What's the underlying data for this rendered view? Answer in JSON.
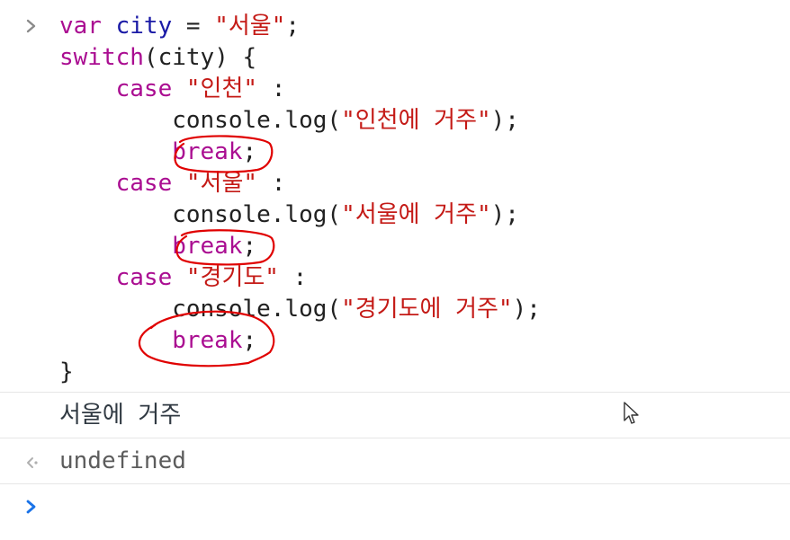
{
  "input": {
    "lines": [
      [
        {
          "t": "var",
          "c": "kw"
        },
        {
          "t": " ",
          "c": "op"
        },
        {
          "t": "city",
          "c": "var-name"
        },
        {
          "t": " = ",
          "c": "op"
        },
        {
          "t": "\"서울\"",
          "c": "str"
        },
        {
          "t": ";",
          "c": "op"
        }
      ],
      [
        {
          "t": "switch",
          "c": "kw"
        },
        {
          "t": "(city) {",
          "c": "op"
        }
      ],
      [
        {
          "t": "    case ",
          "c": "kw"
        },
        {
          "t": "\"인천\"",
          "c": "str"
        },
        {
          "t": " :",
          "c": "op"
        }
      ],
      [
        {
          "t": "        console.log(",
          "c": "fn"
        },
        {
          "t": "\"인천에 거주\"",
          "c": "str"
        },
        {
          "t": ");",
          "c": "op"
        }
      ],
      [
        {
          "t": "        break",
          "c": "kw"
        },
        {
          "t": ";",
          "c": "op"
        }
      ],
      [
        {
          "t": "    case ",
          "c": "kw"
        },
        {
          "t": "\"서울\"",
          "c": "str"
        },
        {
          "t": " :",
          "c": "op"
        }
      ],
      [
        {
          "t": "        console.log(",
          "c": "fn"
        },
        {
          "t": "\"서울에 거주\"",
          "c": "str"
        },
        {
          "t": ");",
          "c": "op"
        }
      ],
      [
        {
          "t": "        break",
          "c": "kw"
        },
        {
          "t": ";",
          "c": "op"
        }
      ],
      [
        {
          "t": "    case ",
          "c": "kw"
        },
        {
          "t": "\"경기도\"",
          "c": "str"
        },
        {
          "t": " :",
          "c": "op"
        }
      ],
      [
        {
          "t": "        console.log(",
          "c": "fn"
        },
        {
          "t": "\"경기도에 거주\"",
          "c": "str"
        },
        {
          "t": ");",
          "c": "op"
        }
      ],
      [
        {
          "t": "        break",
          "c": "kw"
        },
        {
          "t": ";",
          "c": "op"
        }
      ],
      [
        {
          "t": "}",
          "c": "op"
        }
      ]
    ]
  },
  "log": {
    "text": "서울에 거주"
  },
  "result": {
    "text": "undefined"
  },
  "colors": {
    "keyword": "#aa0d91",
    "variable": "#1a1aa6",
    "string": "#c41a16",
    "annotation": "#e00000",
    "prompt": "#1a73e8"
  },
  "icons": {
    "input_prompt": "chevron-right-icon",
    "result_prompt": "result-arrow-icon",
    "active_prompt": "chevron-right-icon"
  }
}
